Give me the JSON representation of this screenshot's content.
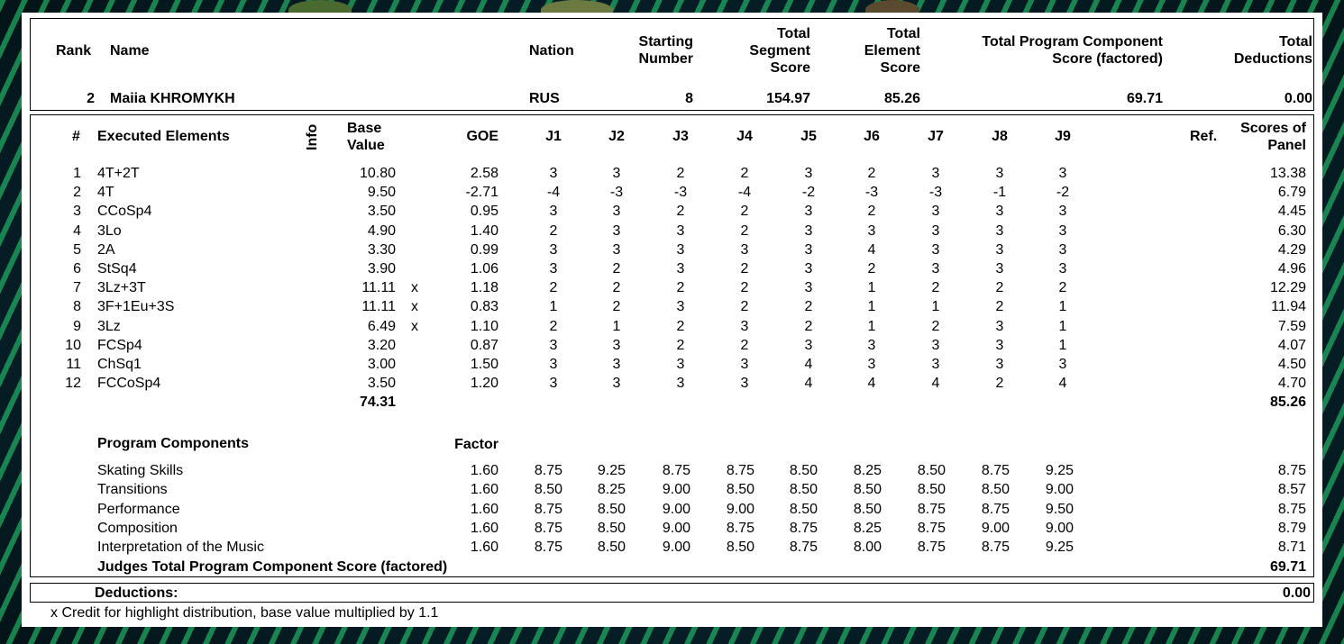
{
  "header": {
    "labels": {
      "rank": "Rank",
      "name": "Name",
      "nation": "Nation",
      "starting_number": [
        "Starting",
        "Number"
      ],
      "tss": [
        "Total",
        "Segment",
        "Score"
      ],
      "tes": [
        "Total",
        "Element",
        "Score"
      ],
      "pcs": [
        "Total Program Component",
        "Score (factored)"
      ],
      "deductions": [
        "Total",
        "Deductions"
      ]
    },
    "skater": {
      "rank": "2",
      "name": "Maiia KHROMYKH",
      "nation": "RUS",
      "starting_number": "8",
      "tss": "154.97",
      "tes": "85.26",
      "pcs": "69.71",
      "deductions": "0.00"
    }
  },
  "elements_header": {
    "num": "#",
    "executed": "Executed Elements",
    "info": "Info",
    "base_value": [
      "Base",
      "Value"
    ],
    "goe": "GOE",
    "judges": [
      "J1",
      "J2",
      "J3",
      "J4",
      "J5",
      "J6",
      "J7",
      "J8",
      "J9"
    ],
    "ref": "Ref.",
    "scores_of_panel": [
      "Scores of",
      "Panel"
    ]
  },
  "elements": [
    {
      "num": "1",
      "name": "4T+2T",
      "base": "10.80",
      "info": "",
      "goe": "2.58",
      "j": [
        "3",
        "3",
        "2",
        "2",
        "3",
        "2",
        "3",
        "3",
        "3"
      ],
      "panel": "13.38"
    },
    {
      "num": "2",
      "name": "4T",
      "base": "9.50",
      "info": "",
      "goe": "-2.71",
      "j": [
        "-4",
        "-3",
        "-3",
        "-4",
        "-2",
        "-3",
        "-3",
        "-1",
        "-2"
      ],
      "panel": "6.79"
    },
    {
      "num": "3",
      "name": "CCoSp4",
      "base": "3.50",
      "info": "",
      "goe": "0.95",
      "j": [
        "3",
        "3",
        "2",
        "2",
        "3",
        "2",
        "3",
        "3",
        "3"
      ],
      "panel": "4.45"
    },
    {
      "num": "4",
      "name": "3Lo",
      "base": "4.90",
      "info": "",
      "goe": "1.40",
      "j": [
        "2",
        "3",
        "3",
        "2",
        "3",
        "3",
        "3",
        "3",
        "3"
      ],
      "panel": "6.30"
    },
    {
      "num": "5",
      "name": "2A",
      "base": "3.30",
      "info": "",
      "goe": "0.99",
      "j": [
        "3",
        "3",
        "3",
        "3",
        "3",
        "4",
        "3",
        "3",
        "3"
      ],
      "panel": "4.29"
    },
    {
      "num": "6",
      "name": "StSq4",
      "base": "3.90",
      "info": "",
      "goe": "1.06",
      "j": [
        "3",
        "2",
        "3",
        "2",
        "3",
        "2",
        "3",
        "3",
        "3"
      ],
      "panel": "4.96"
    },
    {
      "num": "7",
      "name": "3Lz+3T",
      "base": "11.11",
      "info": "x",
      "goe": "1.18",
      "j": [
        "2",
        "2",
        "2",
        "2",
        "3",
        "1",
        "2",
        "2",
        "2"
      ],
      "panel": "12.29"
    },
    {
      "num": "8",
      "name": "3F+1Eu+3S",
      "base": "11.11",
      "info": "x",
      "goe": "0.83",
      "j": [
        "1",
        "2",
        "3",
        "2",
        "2",
        "1",
        "1",
        "2",
        "1"
      ],
      "panel": "11.94"
    },
    {
      "num": "9",
      "name": "3Lz",
      "base": "6.49",
      "info": "x",
      "goe": "1.10",
      "j": [
        "2",
        "1",
        "2",
        "3",
        "2",
        "1",
        "2",
        "3",
        "1"
      ],
      "panel": "7.59"
    },
    {
      "num": "10",
      "name": "FCSp4",
      "base": "3.20",
      "info": "",
      "goe": "0.87",
      "j": [
        "3",
        "3",
        "2",
        "2",
        "3",
        "3",
        "3",
        "3",
        "1"
      ],
      "panel": "4.07"
    },
    {
      "num": "11",
      "name": "ChSq1",
      "base": "3.00",
      "info": "",
      "goe": "1.50",
      "j": [
        "3",
        "3",
        "3",
        "3",
        "4",
        "3",
        "3",
        "3",
        "3"
      ],
      "panel": "4.50"
    },
    {
      "num": "12",
      "name": "FCCoSp4",
      "base": "3.50",
      "info": "",
      "goe": "1.20",
      "j": [
        "3",
        "3",
        "3",
        "3",
        "4",
        "4",
        "4",
        "2",
        "4"
      ],
      "panel": "4.70"
    }
  ],
  "elements_totals": {
    "base": "74.31",
    "panel": "85.26"
  },
  "components_header": {
    "title": "Program Components",
    "factor": "Factor"
  },
  "components": [
    {
      "name": "Skating Skills",
      "factor": "1.60",
      "j": [
        "8.75",
        "9.25",
        "8.75",
        "8.75",
        "8.50",
        "8.25",
        "8.50",
        "8.75",
        "9.25"
      ],
      "panel": "8.75"
    },
    {
      "name": "Transitions",
      "factor": "1.60",
      "j": [
        "8.50",
        "8.25",
        "9.00",
        "8.50",
        "8.50",
        "8.50",
        "8.50",
        "8.50",
        "9.00"
      ],
      "panel": "8.57"
    },
    {
      "name": "Performance",
      "factor": "1.60",
      "j": [
        "8.75",
        "8.50",
        "9.00",
        "9.00",
        "8.50",
        "8.50",
        "8.75",
        "8.75",
        "9.50"
      ],
      "panel": "8.75"
    },
    {
      "name": "Composition",
      "factor": "1.60",
      "j": [
        "8.75",
        "8.50",
        "9.00",
        "8.75",
        "8.75",
        "8.25",
        "8.75",
        "9.00",
        "9.00"
      ],
      "panel": "8.79"
    },
    {
      "name": "Interpretation of the Music",
      "factor": "1.60",
      "j": [
        "8.75",
        "8.50",
        "9.00",
        "8.50",
        "8.75",
        "8.00",
        "8.75",
        "8.75",
        "9.25"
      ],
      "panel": "8.71"
    }
  ],
  "components_total": {
    "label": "Judges Total Program Component Score (factored)",
    "value": "69.71"
  },
  "deductions": {
    "label": "Deductions:",
    "value": "0.00"
  },
  "footnote": "x Credit for highlight distribution, base value multiplied by 1.1"
}
